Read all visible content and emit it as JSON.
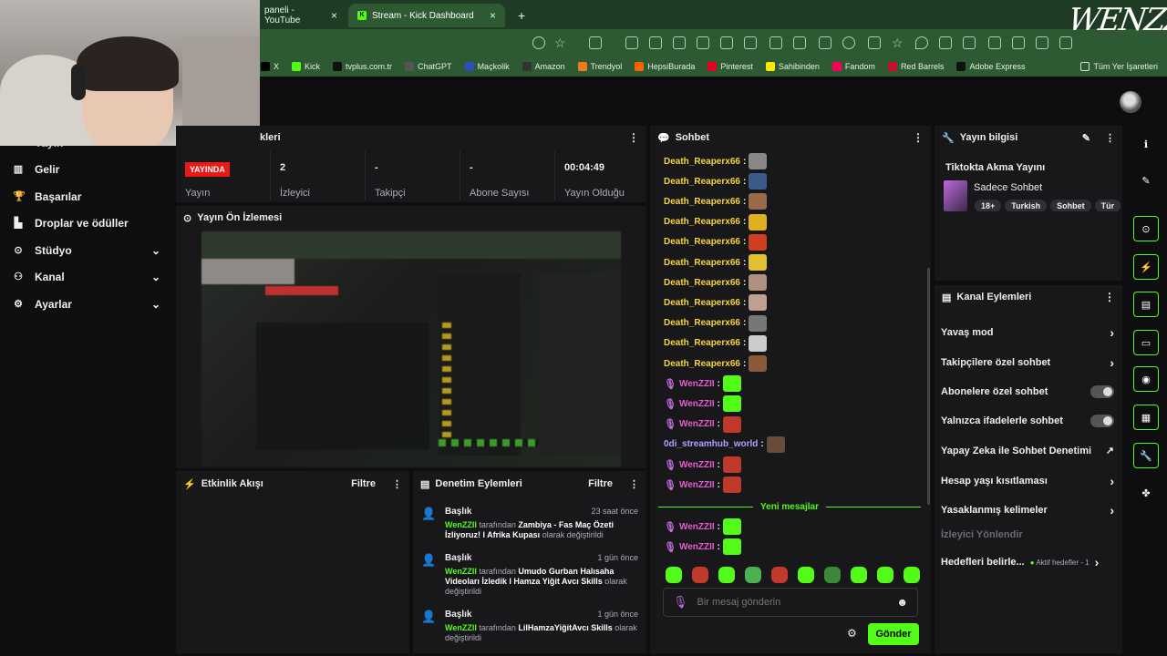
{
  "browser": {
    "tabs": [
      {
        "label": "paneli - YouTube",
        "icon": "youtube-icon"
      },
      {
        "label": "Stream - Kick Dashboard",
        "icon": "kick-icon"
      }
    ],
    "close_glyph": "×",
    "new_tab_glyph": "+",
    "bookmarks": [
      {
        "label": "X",
        "icon": "x-icon",
        "color": "#000000"
      },
      {
        "label": "Kick",
        "icon": "kick-icon",
        "color": "#53fc18"
      },
      {
        "label": "tvplus.com.tr",
        "icon": "tvplus-icon",
        "color": "#111111"
      },
      {
        "label": "ChatGPT",
        "icon": "chatgpt-icon",
        "color": "#555555"
      },
      {
        "label": "Maçkolik",
        "icon": "mackolik-icon",
        "color": "#2b4fbf"
      },
      {
        "label": "Amazon",
        "icon": "amazon-icon",
        "color": "#333333"
      },
      {
        "label": "Trendyol",
        "icon": "trendyol-icon",
        "color": "#f27a1a"
      },
      {
        "label": "HepsiBurada",
        "icon": "hepsiburada-icon",
        "color": "#ff6000"
      },
      {
        "label": "Pinterest",
        "icon": "pinterest-icon",
        "color": "#e60023"
      },
      {
        "label": "Sahibinden",
        "icon": "sahibinden-icon",
        "color": "#ffe800"
      },
      {
        "label": "Fandom",
        "icon": "fandom-icon",
        "color": "#fa005a"
      },
      {
        "label": "Red Barrels",
        "icon": "redbarrels-icon",
        "color": "#c8102e"
      },
      {
        "label": "Adobe Express",
        "icon": "adobe-icon",
        "color": "#111111"
      }
    ],
    "all_bookmarks": "Tüm Yer İşaretleri"
  },
  "nav": {
    "partial_top": "Yayın",
    "items": [
      {
        "label": "Gelir",
        "icon": "revenue-icon",
        "expandable": false
      },
      {
        "label": "Başarılar",
        "icon": "trophy-icon",
        "expandable": false
      },
      {
        "label": "Droplar ve ödüller",
        "icon": "drops-icon",
        "expandable": false
      },
      {
        "label": "Stüdyo",
        "icon": "studio-icon",
        "expandable": true
      },
      {
        "label": "Kanal",
        "icon": "channel-icon",
        "expandable": true
      },
      {
        "label": "Ayarlar",
        "icon": "settings-icon",
        "expandable": true
      }
    ]
  },
  "stats_panel": {
    "title_partial": "kleri",
    "live_badge": "YAYINDA",
    "stats": [
      {
        "label": "Yayın",
        "value": ""
      },
      {
        "label": "İzleyici",
        "value": "2"
      },
      {
        "label": "Takipçi",
        "value": "-"
      },
      {
        "label": "Abone Sayısı",
        "value": "-"
      },
      {
        "label": "Yayın Olduğu",
        "value": "00:04:49"
      }
    ]
  },
  "preview": {
    "title": "Yayın Ön İzlemesi"
  },
  "activity": {
    "title": "Etkinlik Akışı",
    "filter": "Filtre"
  },
  "moderation": {
    "title": "Denetim Eylemleri",
    "filter": "Filtre",
    "items": [
      {
        "title": "Başlık",
        "time": "23 saat önce",
        "user": "WenZZII",
        "by": "tarafından",
        "value": "Zambiya - Fas Maç Özeti İzliyoruz! l Afrika Kupası",
        "suffix": "olarak değiştirildi"
      },
      {
        "title": "Başlık",
        "time": "1 gün önce",
        "user": "WenZZII",
        "by": "tarafından",
        "value": "Umudo Gurban Halısaha Videoları İzledik l Hamza Yiğit Avcı Skills",
        "suffix": "olarak değiştirildi"
      },
      {
        "title": "Başlık",
        "time": "1 gün önce",
        "user": "WenZZII",
        "by": "tarafından",
        "value": "LilHamzaYiğitAvcı Skills",
        "suffix": "olarak değiştirildi"
      }
    ]
  },
  "chat": {
    "title": "Sohbet",
    "messages": [
      {
        "user": "Death_Reaperx66",
        "color": "#f5d33d",
        "mic": false,
        "emote": "#888888"
      },
      {
        "user": "Death_Reaperx66",
        "color": "#f5d33d",
        "mic": false,
        "emote": "#3a5a8a"
      },
      {
        "user": "Death_Reaperx66",
        "color": "#f5d33d",
        "mic": false,
        "emote": "#9a6a4a"
      },
      {
        "user": "Death_Reaperx66",
        "color": "#f5d33d",
        "mic": false,
        "emote": "#e0b020"
      },
      {
        "user": "Death_Reaperx66",
        "color": "#f5d33d",
        "mic": false,
        "emote": "#d04020"
      },
      {
        "user": "Death_Reaperx66",
        "color": "#f5d33d",
        "mic": false,
        "emote": "#e0c030"
      },
      {
        "user": "Death_Reaperx66",
        "color": "#f5d33d",
        "mic": false,
        "emote": "#b09080"
      },
      {
        "user": "Death_Reaperx66",
        "color": "#f5d33d",
        "mic": false,
        "emote": "#c0a090"
      },
      {
        "user": "Death_Reaperx66",
        "color": "#f5d33d",
        "mic": false,
        "emote": "#777777"
      },
      {
        "user": "Death_Reaperx66",
        "color": "#f5d33d",
        "mic": false,
        "emote": "#cccccc"
      },
      {
        "user": "Death_Reaperx66",
        "color": "#f5d33d",
        "mic": false,
        "emote": "#8a5a3a"
      },
      {
        "user": "WenZZII",
        "color": "#e85cd1",
        "mic": true,
        "emote": "#53fc18"
      },
      {
        "user": "WenZZII",
        "color": "#e85cd1",
        "mic": true,
        "emote": "#53fc18"
      },
      {
        "user": "WenZZII",
        "color": "#e85cd1",
        "mic": true,
        "emote": "#c0392b"
      },
      {
        "user": "0di_streamhub_world",
        "color": "#b79cff",
        "mic": false,
        "emote": "#6a4a3a"
      },
      {
        "user": "WenZZII",
        "color": "#e85cd1",
        "mic": true,
        "emote": "#c0392b"
      },
      {
        "user": "WenZZII",
        "color": "#e85cd1",
        "mic": true,
        "emote": "#c0392b"
      }
    ],
    "new_messages": "Yeni mesajlar",
    "after_messages": [
      {
        "user": "WenZZII",
        "color": "#e85cd1",
        "mic": true,
        "emote": "#53fc18"
      },
      {
        "user": "WenZZII",
        "color": "#e85cd1",
        "mic": true,
        "emote": "#53fc18"
      }
    ],
    "emote_bar": [
      "#53fc18",
      "#c0392b",
      "#53fc18",
      "#4caf50",
      "#c0392b",
      "#53fc18",
      "#3a8a3a",
      "#53fc18",
      "#53fc18",
      "#53fc18"
    ],
    "input_placeholder": "Bir mesaj gönderin",
    "send": "Gönder",
    "accent": "#53fc18"
  },
  "stream_info": {
    "title": "Yayın bilgisi",
    "stream_title": "Tiktokta Akma Yayını",
    "category": "Sadece Sohbet",
    "tags": [
      "18+",
      "Turkish",
      "Sohbet",
      "Tür"
    ]
  },
  "channel_actions": {
    "title": "Kanal Eylemleri",
    "items": [
      {
        "label": "Yavaş mod",
        "control": "chevron"
      },
      {
        "label": "Takipçilere özel sohbet",
        "control": "chevron"
      },
      {
        "label": "Abonelere özel sohbet",
        "control": "toggle"
      },
      {
        "label": "Yalnızca ifadelerle sohbet",
        "control": "toggle"
      },
      {
        "label": "Yapay Zeka ile Sohbet Denetimi",
        "control": "external"
      },
      {
        "label": "Hesap yaşı kısıtlaması",
        "control": "chevron"
      },
      {
        "label": "Yasaklanmış kelimeler",
        "control": "chevron"
      },
      {
        "label": "İzleyici Yönlendir",
        "control": "disabled"
      },
      {
        "label": "Hedefleri belirle...",
        "control": "chevron",
        "status": "Aktif hedefler - 1"
      }
    ]
  },
  "right_rail": [
    "info-icon",
    "edit-icon",
    "preview-icon",
    "flash-icon",
    "notes-icon",
    "chat-icon",
    "broadcast-icon",
    "layout-icon",
    "wrench-icon",
    "shapes-icon"
  ],
  "watermark": "WENZZII"
}
